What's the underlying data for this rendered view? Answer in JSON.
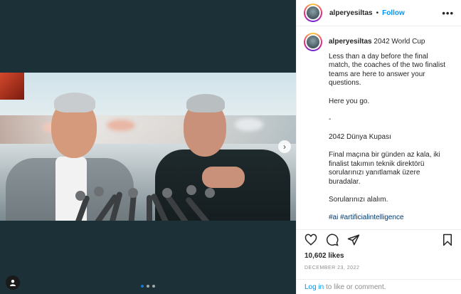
{
  "post": {
    "username": "alperyesiltas",
    "separator": "•",
    "follow_label": "Follow",
    "more_label": "•••",
    "caption_title": "2042 World Cup",
    "caption_paragraphs": [
      "Less than a day before the final match, the coaches of the two finalist teams are here to answer your questions.",
      "Here you go.",
      "-",
      "2042 Dünya Kupası",
      "Final maçına bir günden az kala, iki finalist takımın teknik direktörü sorularınızı yanıtlamak üzere buradalar.",
      "Sorularınızı alalım."
    ],
    "hashtags": "#ai #artificialintelligence",
    "likes": "10,602 likes",
    "date": "DECEMBER 23, 2022",
    "comment_login": "Log in",
    "comment_rest": " to like or comment."
  },
  "media": {
    "carousel_dots": 3,
    "active_dot": 0,
    "next_arrow": "›"
  },
  "icons": {
    "like": "heart-icon",
    "comment": "comment-icon",
    "share": "share-icon",
    "save": "bookmark-icon",
    "tag": "user-tag-icon",
    "next": "chevron-right-icon"
  },
  "colors": {
    "link_blue": "#0095f6",
    "hashtag_blue": "#00376b",
    "media_bg": "#1b3037"
  }
}
